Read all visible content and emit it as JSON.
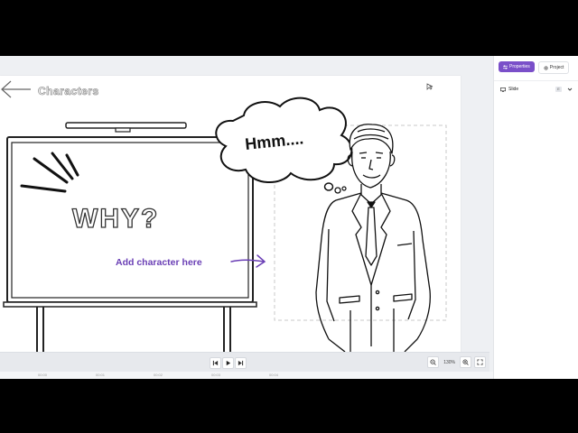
{
  "slide": {
    "heading": "Characters",
    "why_text": "WHY?",
    "thought_text": "Hmm....",
    "add_character_label": "Add character here"
  },
  "panel": {
    "tabs": [
      {
        "label": "Properties",
        "icon": "sliders-icon",
        "active": true
      },
      {
        "label": "Project",
        "icon": "gear-icon",
        "active": false
      }
    ],
    "section_label": "Slide",
    "section_badge": "E"
  },
  "playbar": {
    "zoom_label": "130%"
  },
  "timeline": {
    "ticks": [
      "00:00",
      "00:01",
      "00:02",
      "00:03",
      "00:04"
    ]
  },
  "colors": {
    "accent": "#7a4fc9",
    "add_character_text": "#6a3fb5"
  }
}
